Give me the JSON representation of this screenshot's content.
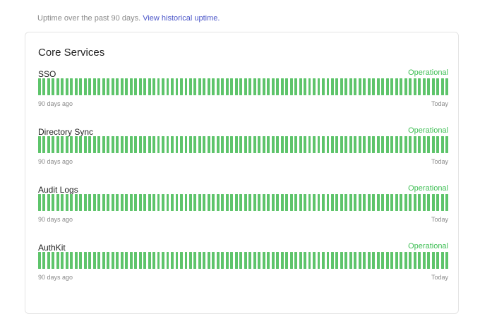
{
  "header": {
    "intro_text": "Uptime over the past 90 days.",
    "history_link": "View historical uptime."
  },
  "card": {
    "title": "Core Services",
    "range_start_label": "90 days ago",
    "range_end_label": "Today",
    "bar_count": 90,
    "bar_color": "#5ec46b",
    "status_color": "#3fbf55",
    "services": [
      {
        "name": "SSO",
        "status": "Operational"
      },
      {
        "name": "Directory Sync",
        "status": "Operational"
      },
      {
        "name": "Audit Logs",
        "status": "Operational"
      },
      {
        "name": "AuthKit",
        "status": "Operational"
      }
    ]
  }
}
